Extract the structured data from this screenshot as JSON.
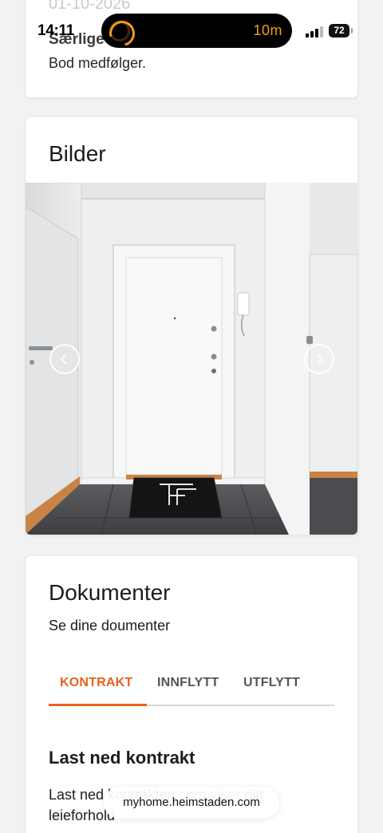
{
  "status_bar": {
    "time": "14:11",
    "timer_text": "10m",
    "battery_level": "72",
    "accent_color": "#f39a1e"
  },
  "top_card": {
    "date_text": "01-10-2026",
    "heading": "Særlige",
    "text": "Bod medfølger."
  },
  "images_card": {
    "title": "Bilder",
    "prev_icon": "chevron-left-icon",
    "next_icon": "chevron-right-icon"
  },
  "documents_card": {
    "title": "Dokumenter",
    "subtitle": "Se dine doumenter",
    "tabs": [
      {
        "label": "KONTRAKT",
        "active": true
      },
      {
        "label": "INNFLYTT",
        "active": false
      },
      {
        "label": "UTFLYTT",
        "active": false
      }
    ],
    "section_heading": "Last ned kontrakt",
    "section_text": "Last ned kontrakten som viser ditt leieforhold"
  },
  "browser": {
    "url": "myhome.heimstaden.com"
  },
  "colors": {
    "accent": "#e8611a",
    "card_background": "#ffffff",
    "page_background": "#f2f2f2"
  }
}
